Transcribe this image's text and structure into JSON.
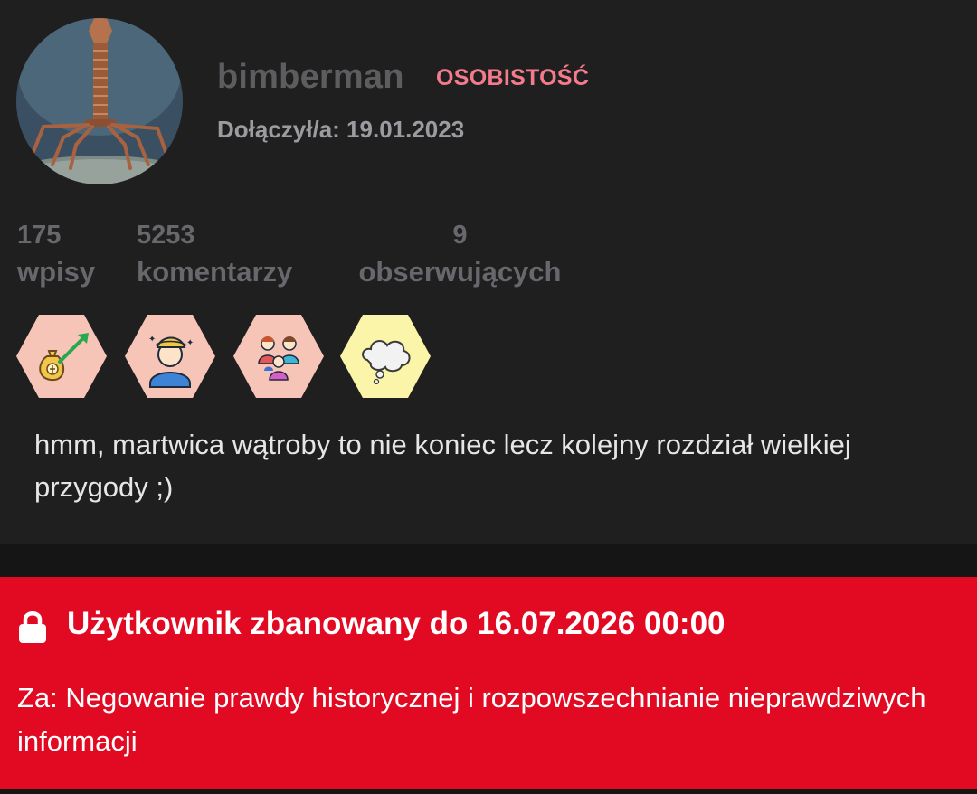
{
  "profile": {
    "username": "bimberman",
    "rank": "OSOBISTOŚĆ",
    "joined": "Dołączył/a: 19.01.2023",
    "avatar_icon": "bacteriophage-avatar",
    "bio": "hmm, martwica wątroby to nie koniec lecz kolejny rozdział wielkiej przygody ;)"
  },
  "stats": {
    "posts": {
      "count": "175",
      "label": "wpisy"
    },
    "comments": {
      "count": "5253",
      "label": "komentarzy"
    },
    "followers": {
      "count": "9",
      "label": "obserwujących"
    }
  },
  "badges": [
    {
      "icon": "money-bag-growth-icon",
      "color": "#f7c4b8"
    },
    {
      "icon": "dizzy-person-icon",
      "color": "#f7c4b8"
    },
    {
      "icon": "group-people-icon",
      "color": "#f7c4b8"
    },
    {
      "icon": "cloud-thought-icon",
      "color": "#faf5a8"
    }
  ],
  "ban": {
    "title": "Użytkownik zbanowany do 16.07.2026 00:00",
    "reason": "Za: Negowanie prawdy historycznej i rozpowszechnianie nieprawdziwych informacji",
    "color": "#e20a22",
    "icon": "lock-icon"
  }
}
